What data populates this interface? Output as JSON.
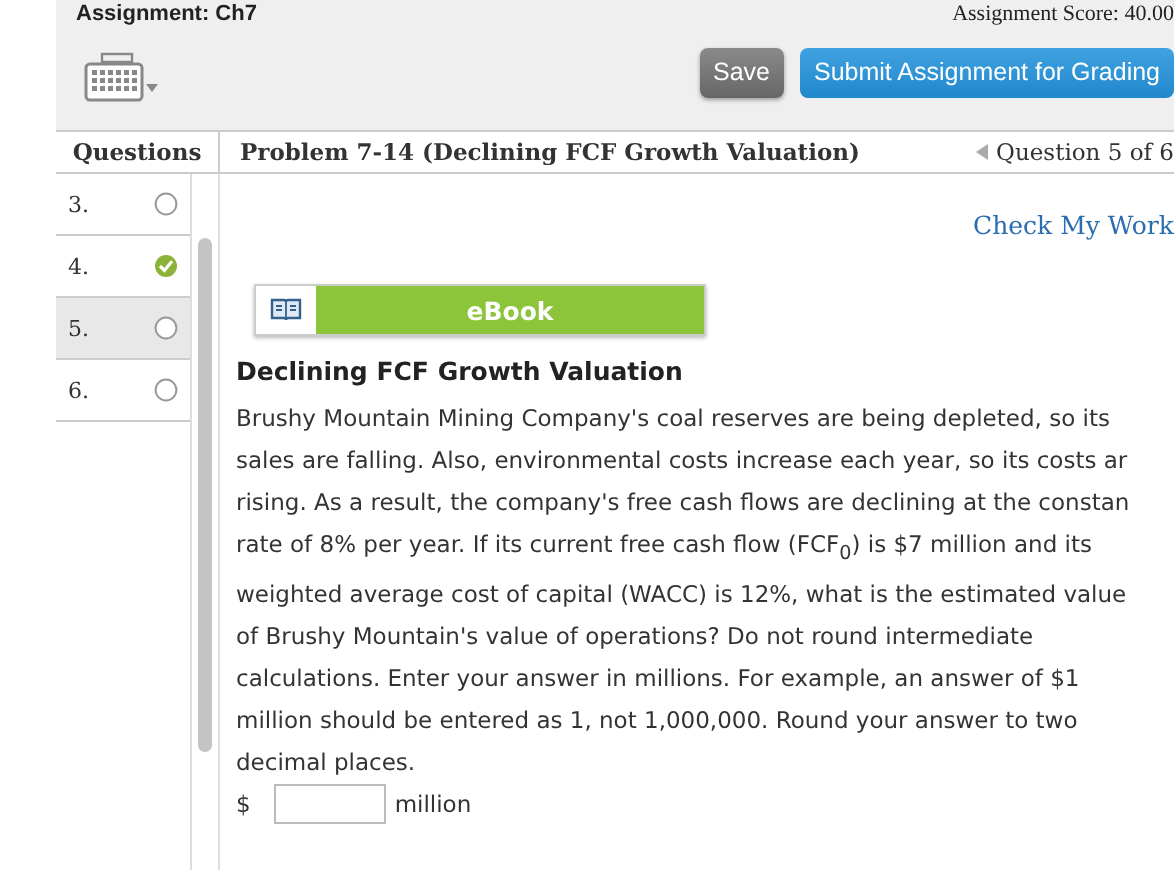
{
  "assignment": {
    "title": "Assignment: Ch7",
    "score": "Assignment Score: 40.00"
  },
  "toolbar": {
    "buttons": [
      {
        "label": "Save",
        "kind": "secondary"
      },
      {
        "label": "Submit Assignment for Grading",
        "kind": "primary"
      }
    ]
  },
  "questions_header": "Questions",
  "questions": [
    {
      "number": "3.",
      "answered": false,
      "selected": false
    },
    {
      "number": "4.",
      "answered": true,
      "selected": false
    },
    {
      "number": "5.",
      "answered": false,
      "selected": true
    },
    {
      "number": "6.",
      "answered": false,
      "selected": false
    }
  ],
  "problem": {
    "title": "Problem 7-14 (Declining FCF Growth Valuation)",
    "position": "Question 5 of 6",
    "check_link": "Check My Work",
    "ebook": "eBook",
    "heading": "Declining FCF Growth Valuation",
    "lines": [
      "Brushy Mountain Mining Company's coal reserves are being depleted, so its",
      "sales are falling. Also, environmental costs increase each year, so its costs ar",
      "rising. As a result, the company's free cash flows are declining at the constan",
      "rate of 8% per year. If its current free cash flow (FCF$_{0}$) is $7 million and its",
      "weighted average cost of capital (WACC) is 12%, what is the estimated value",
      "of Brushy Mountain's value of operations? Do not round intermediate",
      "calculations. Enter your answer in millions. For example, an answer of $1",
      "million should be entered as 1, not 1,000,000. Round your answer to two",
      "decimal places."
    ],
    "answer": {
      "prefix": "$",
      "suffix": "million"
    }
  }
}
